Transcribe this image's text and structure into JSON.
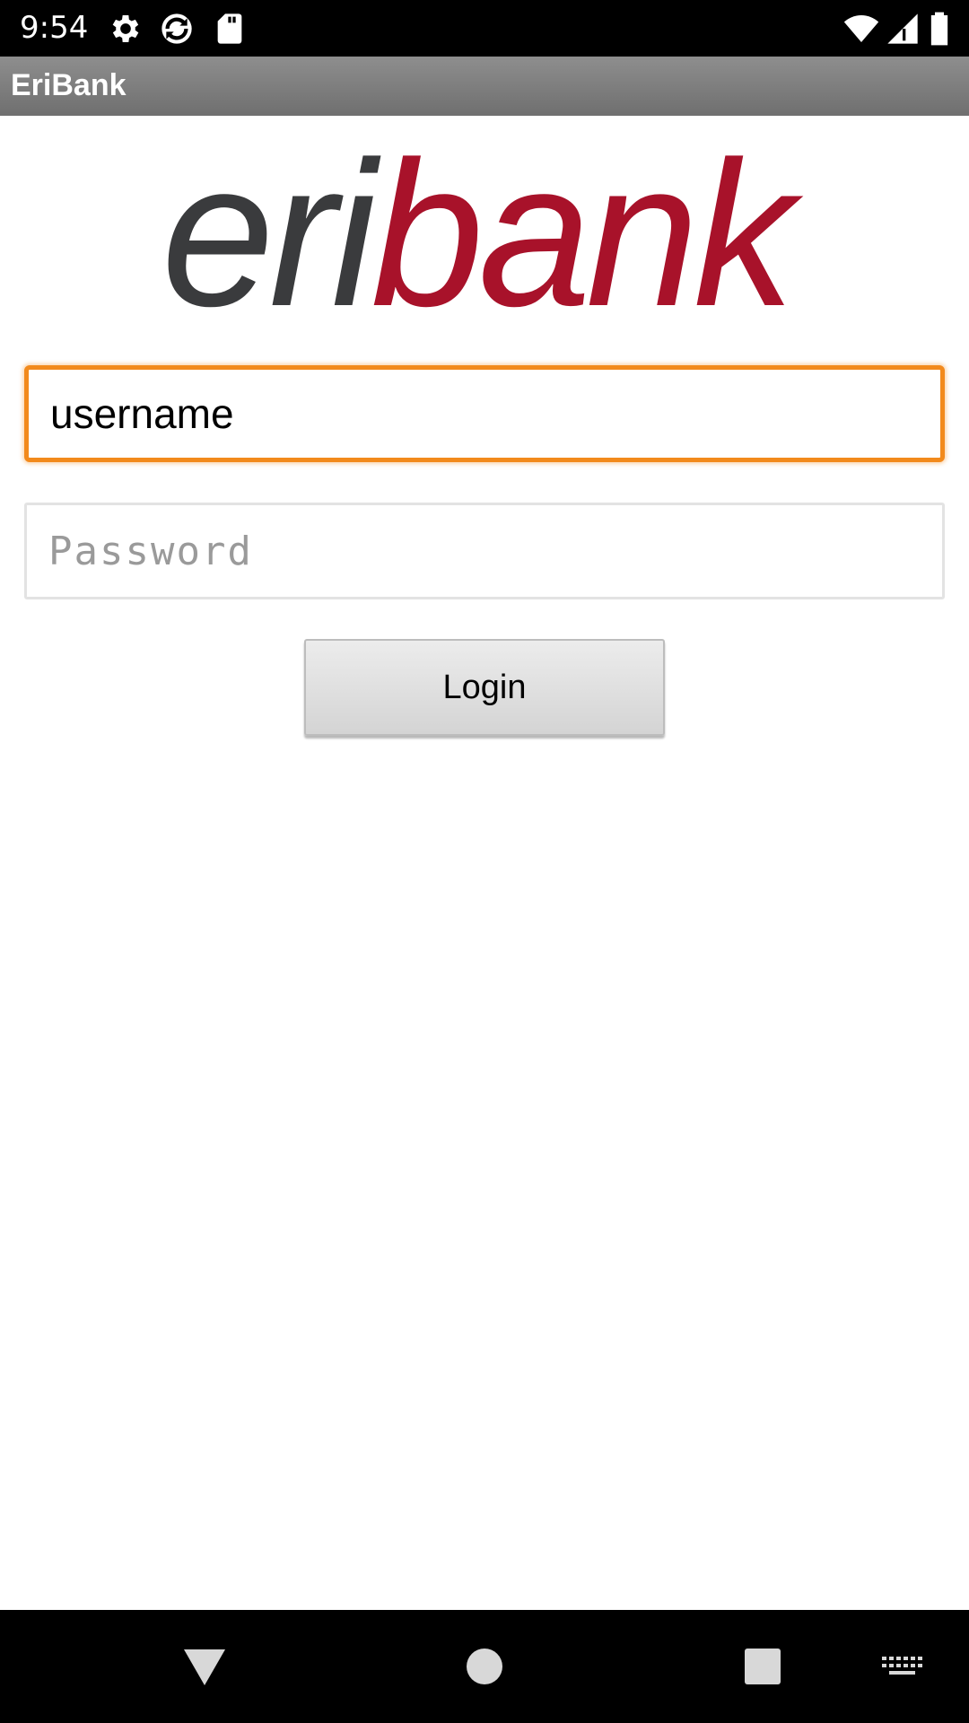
{
  "status_bar": {
    "time": "9:54",
    "icons": [
      "gear-icon",
      "sync-icon",
      "sd-card-icon",
      "wifi-icon",
      "cell-signal-icon",
      "battery-icon"
    ]
  },
  "app_bar": {
    "title": "EriBank"
  },
  "logo": {
    "part1": "eri",
    "part2": "bank",
    "colors": {
      "part1": "#3a3b3d",
      "part2": "#a8122a"
    }
  },
  "login_form": {
    "username": {
      "value": "username",
      "focused": true
    },
    "password": {
      "value": "",
      "placeholder": "Password"
    },
    "login_label": "Login"
  },
  "nav_bar": {
    "icons": [
      "back-icon",
      "home-icon",
      "recents-icon",
      "keyboard-icon"
    ]
  },
  "colors": {
    "focus_border": "#f28a1c",
    "app_bar": "#7f7f7f"
  }
}
